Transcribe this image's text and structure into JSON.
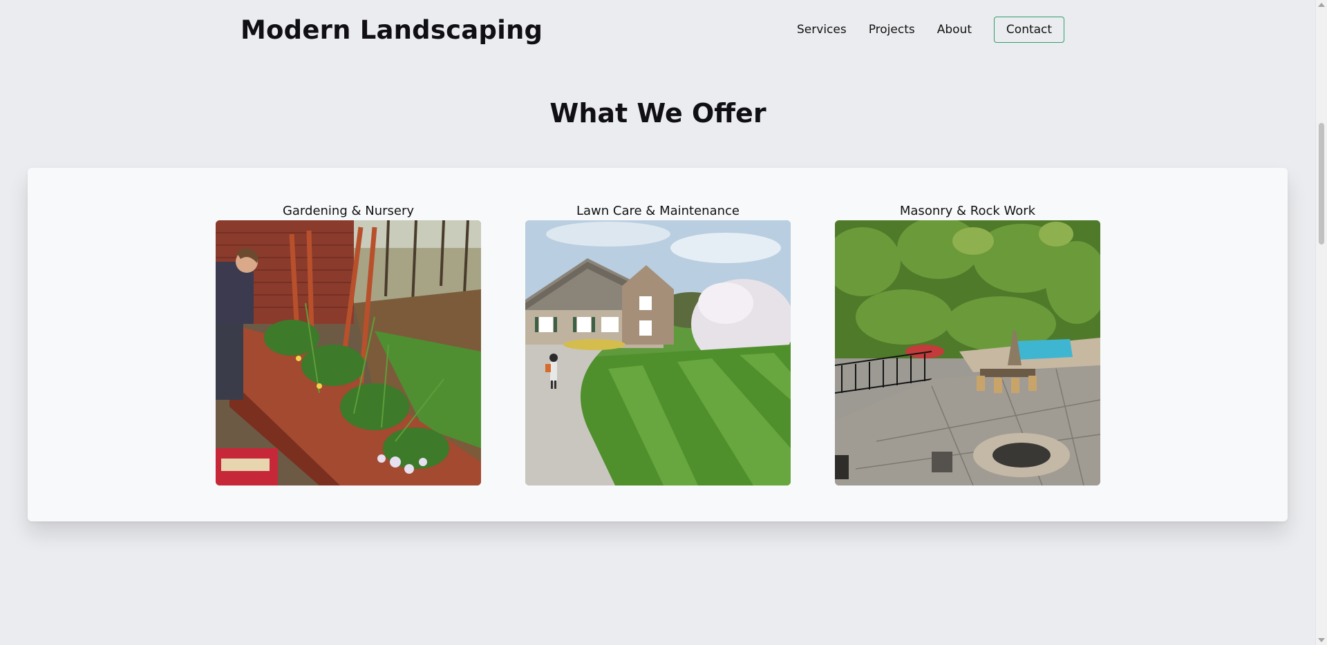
{
  "header": {
    "brand": "Modern Landscaping",
    "nav": {
      "services": "Services",
      "projects": "Projects",
      "about": "About",
      "contact": "Contact"
    },
    "accent_color": "#2e9e6a"
  },
  "section": {
    "title": "What We Offer"
  },
  "services": [
    {
      "title": "Gardening & Nursery",
      "image": "gardener-planter-photo"
    },
    {
      "title": "Lawn Care & Maintenance",
      "image": "striped-lawn-house-photo"
    },
    {
      "title": "Masonry & Rock Work",
      "image": "stone-patio-pool-photo"
    }
  ]
}
